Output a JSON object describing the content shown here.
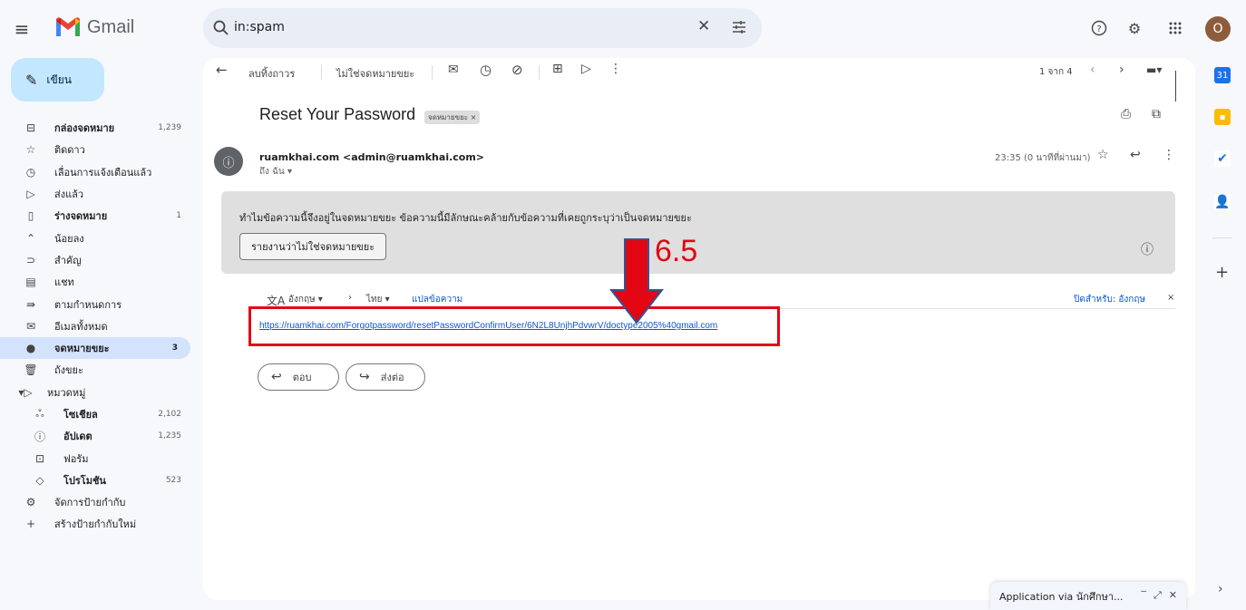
{
  "brand": {
    "name": "Gmail"
  },
  "search": {
    "query": "in:spam"
  },
  "nav": {
    "compose_label": "เขียน",
    "items": [
      {
        "icon": "inbox-icon",
        "label": "กล่องจดหมาย",
        "count": "1,239"
      },
      {
        "icon": "star-icon",
        "label": "ติดดาว",
        "count": ""
      },
      {
        "icon": "clock-icon",
        "label": "เลื่อนการแจ้งเตือนแล้ว",
        "count": ""
      },
      {
        "icon": "send-icon",
        "label": "ส่งแล้ว",
        "count": ""
      },
      {
        "icon": "draft-icon",
        "label": "ร่างจดหมาย",
        "count": "1"
      },
      {
        "icon": "chevron-up-icon",
        "label": "น้อยลง",
        "count": ""
      },
      {
        "icon": "important-icon",
        "label": "สำคัญ",
        "count": ""
      },
      {
        "icon": "chat-icon",
        "label": "แชท",
        "count": ""
      },
      {
        "icon": "scheduled-icon",
        "label": "ตามกำหนดการ",
        "count": ""
      },
      {
        "icon": "all-mail-icon",
        "label": "อีเมลทั้งหมด",
        "count": ""
      },
      {
        "icon": "spam-icon",
        "label": "จดหมายขยะ",
        "count": "3"
      },
      {
        "icon": "trash-icon",
        "label": "ถังขยะ",
        "count": ""
      },
      {
        "icon": "category-icon",
        "label": "หมวดหมู่",
        "count": ""
      },
      {
        "icon": "social-icon",
        "label": "โซเชียล",
        "count": "2,102"
      },
      {
        "icon": "updates-icon",
        "label": "อัปเดต",
        "count": "1,235"
      },
      {
        "icon": "forum-icon",
        "label": "ฟอรัม",
        "count": ""
      },
      {
        "icon": "promotions-icon",
        "label": "โปรโมชัน",
        "count": "523"
      },
      {
        "icon": "manage-labels-icon",
        "label": "จัดการป้ายกำกับ",
        "count": ""
      },
      {
        "icon": "plus-icon",
        "label": "สร้างป้ายกำกับใหม่",
        "count": ""
      }
    ]
  },
  "toolbar": {
    "delete_forever": "ลบทิ้งถาวร",
    "not_spam": "ไม่ใช่จดหมายขยะ",
    "pagination": "1 จาก 4"
  },
  "email": {
    "subject": "Reset Your Password",
    "label_chip": "จดหมายขยะ ×",
    "sender": "ruamkhai.com <admin@ruamkhai.com>",
    "to": "ถึง ฉัน ▾",
    "time": "23:35 (0 นาทีที่ผ่านมา)",
    "spam_reason": "ทำไมข้อความนี้จึงอยู่ในจดหมายขยะ ข้อความนี้มีลักษณะคล้ายกับข้อความที่เคยถูกระบุว่าเป็นจดหมายขยะ",
    "report_not_spam": "รายงานว่าไม่ใช่จดหมายขยะ",
    "translate_from": "อังกฤษ ▾",
    "translate_to": "ไทย ▾",
    "translate_action": "แปลข้อความ",
    "turn_off_for": "ปิดสำหรับ: อังกฤษ",
    "link": "https://ruamkhai.com/Forgotpassword/resetPasswordConfirmUser/6N2L8UnjhPdvwrV/doctype2005%40gmail.com",
    "reply": "ตอบ",
    "forward": "ส่งต่อ"
  },
  "annotation": {
    "label": "6.5"
  },
  "mini_window": {
    "title": "Application via นักศึกษา..."
  }
}
